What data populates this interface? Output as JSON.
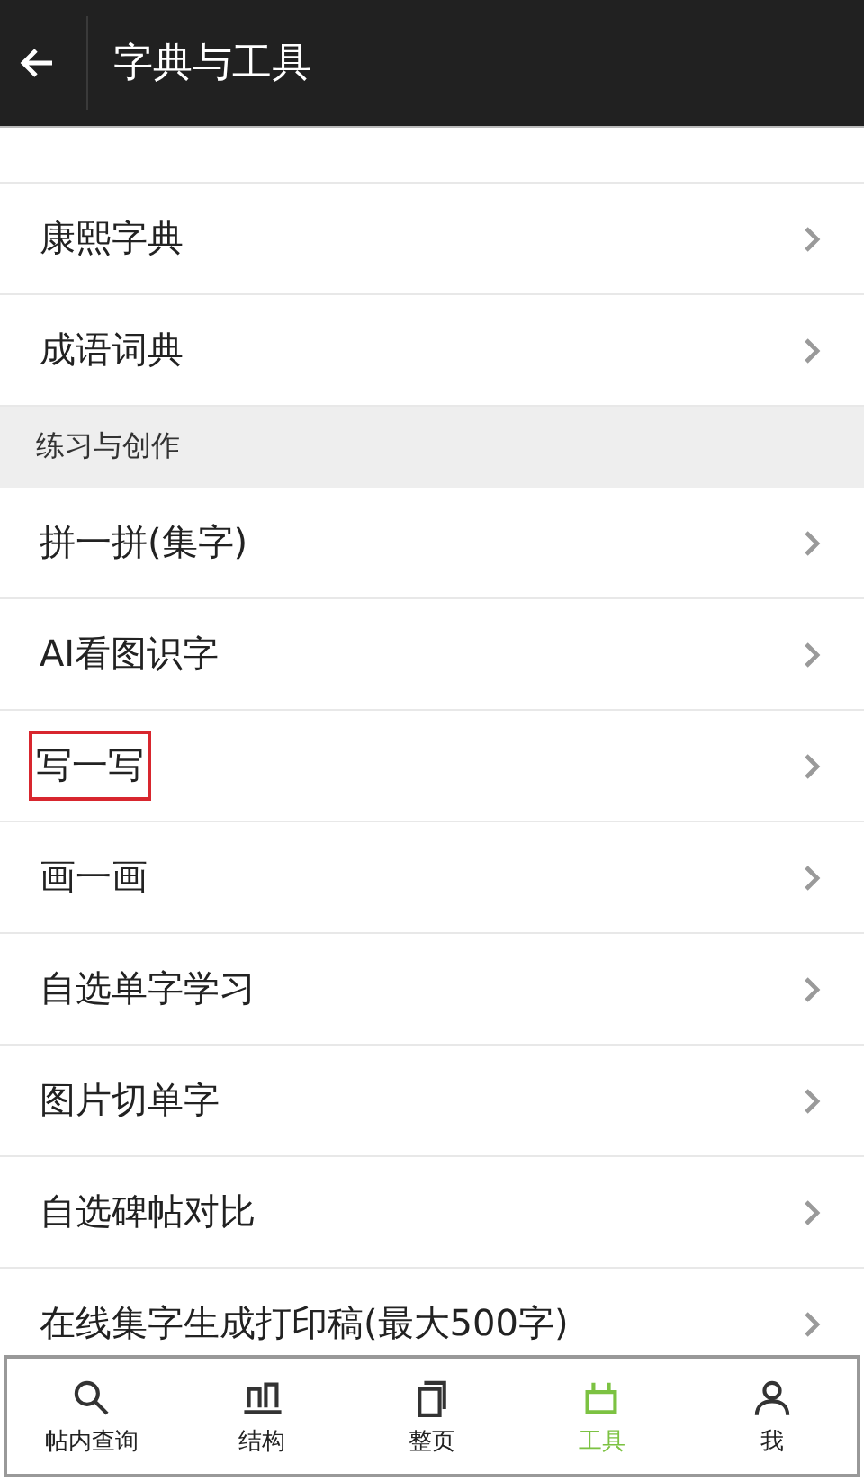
{
  "header": {
    "title": "字典与工具"
  },
  "list": [
    {
      "kind": "item",
      "label": "康熙字典",
      "highlighted": false
    },
    {
      "kind": "item",
      "label": "成语词典",
      "highlighted": false
    },
    {
      "kind": "section",
      "label": "练习与创作"
    },
    {
      "kind": "item",
      "label": "拼一拼(集字)",
      "highlighted": false
    },
    {
      "kind": "item",
      "label": "AI看图识字",
      "highlighted": false
    },
    {
      "kind": "item",
      "label": "写一写",
      "highlighted": true
    },
    {
      "kind": "item",
      "label": "画一画",
      "highlighted": false
    },
    {
      "kind": "item",
      "label": "自选单字学习",
      "highlighted": false
    },
    {
      "kind": "item",
      "label": "图片切单字",
      "highlighted": false
    },
    {
      "kind": "item",
      "label": "自选碑帖对比",
      "highlighted": false
    },
    {
      "kind": "item",
      "label": "在线集字生成打印稿(最大500字)",
      "highlighted": false
    }
  ],
  "tabs": [
    {
      "label": "帖内查询",
      "kind": "search",
      "selected": false
    },
    {
      "label": "结构",
      "kind": "structure",
      "selected": false
    },
    {
      "label": "整页",
      "kind": "page",
      "selected": false
    },
    {
      "label": "工具",
      "kind": "tools",
      "selected": true
    },
    {
      "label": "我",
      "kind": "person",
      "selected": false
    }
  ]
}
